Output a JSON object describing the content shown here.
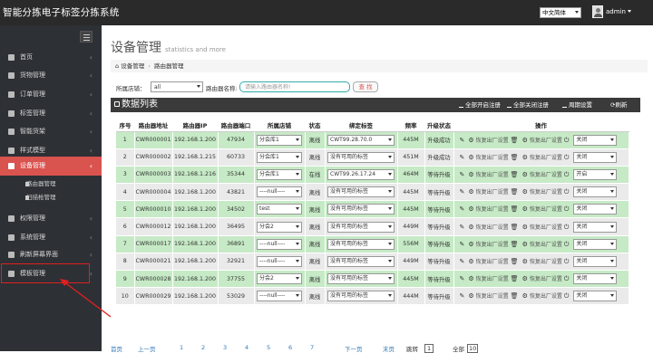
{
  "app": {
    "title": "智能分拣电子标签分拣系统"
  },
  "topbar": {
    "language": "中文简体",
    "user": "admin"
  },
  "sidebar": {
    "items": [
      {
        "label": "首页",
        "icon": "home-icon"
      },
      {
        "label": "货物管理",
        "icon": "box-icon"
      },
      {
        "label": "订单管理",
        "icon": "order-icon"
      },
      {
        "label": "标签管理",
        "icon": "tag-icon"
      },
      {
        "label": "智能货架",
        "icon": "shelf-icon"
      },
      {
        "label": "样式模型",
        "icon": "style-icon"
      },
      {
        "label": "设备管理",
        "icon": "device-icon"
      },
      {
        "label": "权限管理",
        "icon": "lock-icon"
      },
      {
        "label": "系统管理",
        "icon": "gear-icon"
      },
      {
        "label": "刷新屏幕界面",
        "icon": "refresh-icon"
      },
      {
        "label": "模板管理",
        "icon": "template-icon"
      }
    ],
    "sub_items": [
      {
        "label": "路由器管理"
      },
      {
        "label": "扫描枪管理"
      }
    ]
  },
  "page": {
    "title": "设备管理",
    "subtitle": "statistics and more"
  },
  "breadcrumb": {
    "home": "设备管理",
    "current": "路由器管理"
  },
  "filters": {
    "shop_label": "所属店铺：",
    "shop_value": "all",
    "name_label": "路由器名称:",
    "name_placeholder": "请输入路由器名称!",
    "search_label": "查 找"
  },
  "panel": {
    "title": "数据列表",
    "buttons": [
      "全部开启注册",
      "全部关闭注册",
      "周期设置",
      "刷新"
    ]
  },
  "table": {
    "headers": [
      "序号",
      "路由器地址",
      "路由器IP",
      "路由器端口",
      "所属店铺",
      "状态",
      "绑定标签",
      "频率",
      "升级状态",
      "操作"
    ],
    "action_label": "恢复出厂设置",
    "rows": [
      {
        "no": "1",
        "addr": "CWR000001",
        "ip": "192.168.1.200",
        "port": "47934",
        "shop": "分会库1",
        "status": "离线",
        "tag": "CWT99.28.70.0",
        "freq": "445M",
        "upgrade": "升级成功",
        "mode": "关闭"
      },
      {
        "no": "2",
        "addr": "CWR000002",
        "ip": "192.168.1.215",
        "port": "60733",
        "shop": "分会库1",
        "status": "离线",
        "tag": "没有可用的标签",
        "freq": "451M",
        "upgrade": "升级成功",
        "mode": "关闭"
      },
      {
        "no": "3",
        "addr": "CWR000003",
        "ip": "192.168.1.216",
        "port": "35344",
        "shop": "分会库1",
        "status": "在线",
        "tag": "CWT99.26.17.24",
        "freq": "464M",
        "upgrade": "等待升级",
        "mode": "开启"
      },
      {
        "no": "4",
        "addr": "CWR000004",
        "ip": "192.168.1.200",
        "port": "43821",
        "shop": "----null----",
        "status": "离线",
        "tag": "没有可用的标签",
        "freq": "445M",
        "upgrade": "等待升级",
        "mode": "关闭"
      },
      {
        "no": "5",
        "addr": "CWR000010",
        "ip": "192.168.1.200",
        "port": "34502",
        "shop": "test",
        "status": "离线",
        "tag": "没有可用的标签",
        "freq": "445M",
        "upgrade": "等待升级",
        "mode": "关闭"
      },
      {
        "no": "6",
        "addr": "CWR000012",
        "ip": "192.168.1.200",
        "port": "36495",
        "shop": "分会2",
        "status": "离线",
        "tag": "没有可用的标签",
        "freq": "449M",
        "upgrade": "等待升级",
        "mode": "关闭"
      },
      {
        "no": "7",
        "addr": "CWR000017",
        "ip": "192.168.1.200",
        "port": "36891",
        "shop": "----null----",
        "status": "离线",
        "tag": "没有可用的标签",
        "freq": "556M",
        "upgrade": "等待升级",
        "mode": "关闭"
      },
      {
        "no": "8",
        "addr": "CWR000021",
        "ip": "192.168.1.200",
        "port": "32921",
        "shop": "----null----",
        "status": "离线",
        "tag": "没有可用的标签",
        "freq": "449M",
        "upgrade": "等待升级",
        "mode": "关闭"
      },
      {
        "no": "9",
        "addr": "CWR000028",
        "ip": "192.168.1.200",
        "port": "37755",
        "shop": "分会2",
        "status": "离线",
        "tag": "没有可用的标签",
        "freq": "445M",
        "upgrade": "等待升级",
        "mode": "关闭"
      },
      {
        "no": "10",
        "addr": "CWR000029",
        "ip": "192.168.1.200",
        "port": "53029",
        "shop": "----null----",
        "status": "离线",
        "tag": "没有可用的标签",
        "freq": "444M",
        "upgrade": "等待升级",
        "mode": "关闭"
      }
    ]
  },
  "pagination": {
    "first": "首页",
    "prev": "上一页",
    "pages": [
      "1",
      "2",
      "3",
      "4",
      "5",
      "6",
      "7"
    ],
    "next": "下一页",
    "last": "末页",
    "jump_label": "跳转",
    "jump_value": "1",
    "total_label": "全部",
    "total_value": "10"
  },
  "colors": {
    "accent": "#d9534f",
    "topbar": "#2a2a2a",
    "sidebar": "#2d3035",
    "row_green": "#c6eac6",
    "row_gray": "#eaeaea"
  }
}
